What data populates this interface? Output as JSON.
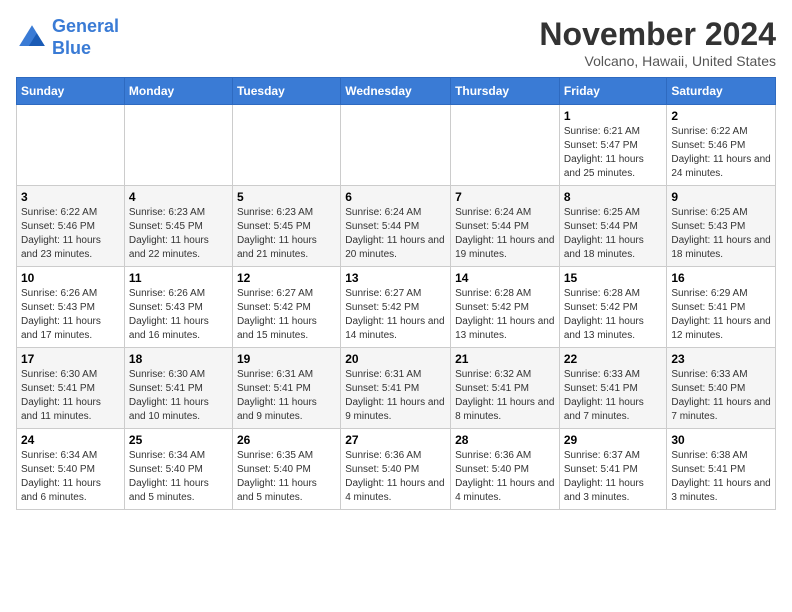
{
  "header": {
    "logo_line1": "General",
    "logo_line2": "Blue",
    "month": "November 2024",
    "location": "Volcano, Hawaii, United States"
  },
  "days_of_week": [
    "Sunday",
    "Monday",
    "Tuesday",
    "Wednesday",
    "Thursday",
    "Friday",
    "Saturday"
  ],
  "weeks": [
    [
      {
        "day": "",
        "info": ""
      },
      {
        "day": "",
        "info": ""
      },
      {
        "day": "",
        "info": ""
      },
      {
        "day": "",
        "info": ""
      },
      {
        "day": "",
        "info": ""
      },
      {
        "day": "1",
        "info": "Sunrise: 6:21 AM\nSunset: 5:47 PM\nDaylight: 11 hours and 25 minutes."
      },
      {
        "day": "2",
        "info": "Sunrise: 6:22 AM\nSunset: 5:46 PM\nDaylight: 11 hours and 24 minutes."
      }
    ],
    [
      {
        "day": "3",
        "info": "Sunrise: 6:22 AM\nSunset: 5:46 PM\nDaylight: 11 hours and 23 minutes."
      },
      {
        "day": "4",
        "info": "Sunrise: 6:23 AM\nSunset: 5:45 PM\nDaylight: 11 hours and 22 minutes."
      },
      {
        "day": "5",
        "info": "Sunrise: 6:23 AM\nSunset: 5:45 PM\nDaylight: 11 hours and 21 minutes."
      },
      {
        "day": "6",
        "info": "Sunrise: 6:24 AM\nSunset: 5:44 PM\nDaylight: 11 hours and 20 minutes."
      },
      {
        "day": "7",
        "info": "Sunrise: 6:24 AM\nSunset: 5:44 PM\nDaylight: 11 hours and 19 minutes."
      },
      {
        "day": "8",
        "info": "Sunrise: 6:25 AM\nSunset: 5:44 PM\nDaylight: 11 hours and 18 minutes."
      },
      {
        "day": "9",
        "info": "Sunrise: 6:25 AM\nSunset: 5:43 PM\nDaylight: 11 hours and 18 minutes."
      }
    ],
    [
      {
        "day": "10",
        "info": "Sunrise: 6:26 AM\nSunset: 5:43 PM\nDaylight: 11 hours and 17 minutes."
      },
      {
        "day": "11",
        "info": "Sunrise: 6:26 AM\nSunset: 5:43 PM\nDaylight: 11 hours and 16 minutes."
      },
      {
        "day": "12",
        "info": "Sunrise: 6:27 AM\nSunset: 5:42 PM\nDaylight: 11 hours and 15 minutes."
      },
      {
        "day": "13",
        "info": "Sunrise: 6:27 AM\nSunset: 5:42 PM\nDaylight: 11 hours and 14 minutes."
      },
      {
        "day": "14",
        "info": "Sunrise: 6:28 AM\nSunset: 5:42 PM\nDaylight: 11 hours and 13 minutes."
      },
      {
        "day": "15",
        "info": "Sunrise: 6:28 AM\nSunset: 5:42 PM\nDaylight: 11 hours and 13 minutes."
      },
      {
        "day": "16",
        "info": "Sunrise: 6:29 AM\nSunset: 5:41 PM\nDaylight: 11 hours and 12 minutes."
      }
    ],
    [
      {
        "day": "17",
        "info": "Sunrise: 6:30 AM\nSunset: 5:41 PM\nDaylight: 11 hours and 11 minutes."
      },
      {
        "day": "18",
        "info": "Sunrise: 6:30 AM\nSunset: 5:41 PM\nDaylight: 11 hours and 10 minutes."
      },
      {
        "day": "19",
        "info": "Sunrise: 6:31 AM\nSunset: 5:41 PM\nDaylight: 11 hours and 9 minutes."
      },
      {
        "day": "20",
        "info": "Sunrise: 6:31 AM\nSunset: 5:41 PM\nDaylight: 11 hours and 9 minutes."
      },
      {
        "day": "21",
        "info": "Sunrise: 6:32 AM\nSunset: 5:41 PM\nDaylight: 11 hours and 8 minutes."
      },
      {
        "day": "22",
        "info": "Sunrise: 6:33 AM\nSunset: 5:41 PM\nDaylight: 11 hours and 7 minutes."
      },
      {
        "day": "23",
        "info": "Sunrise: 6:33 AM\nSunset: 5:40 PM\nDaylight: 11 hours and 7 minutes."
      }
    ],
    [
      {
        "day": "24",
        "info": "Sunrise: 6:34 AM\nSunset: 5:40 PM\nDaylight: 11 hours and 6 minutes."
      },
      {
        "day": "25",
        "info": "Sunrise: 6:34 AM\nSunset: 5:40 PM\nDaylight: 11 hours and 5 minutes."
      },
      {
        "day": "26",
        "info": "Sunrise: 6:35 AM\nSunset: 5:40 PM\nDaylight: 11 hours and 5 minutes."
      },
      {
        "day": "27",
        "info": "Sunrise: 6:36 AM\nSunset: 5:40 PM\nDaylight: 11 hours and 4 minutes."
      },
      {
        "day": "28",
        "info": "Sunrise: 6:36 AM\nSunset: 5:40 PM\nDaylight: 11 hours and 4 minutes."
      },
      {
        "day": "29",
        "info": "Sunrise: 6:37 AM\nSunset: 5:41 PM\nDaylight: 11 hours and 3 minutes."
      },
      {
        "day": "30",
        "info": "Sunrise: 6:38 AM\nSunset: 5:41 PM\nDaylight: 11 hours and 3 minutes."
      }
    ]
  ]
}
